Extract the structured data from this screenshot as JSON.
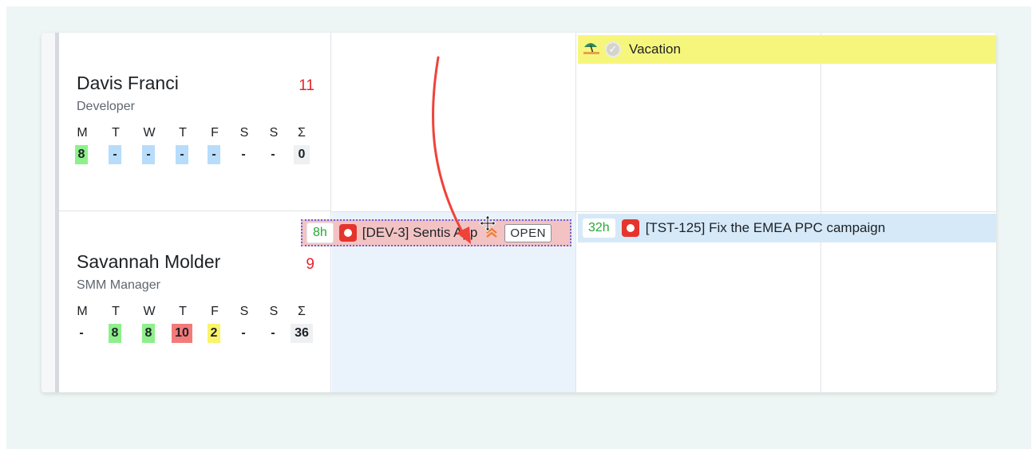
{
  "people": [
    {
      "name": "Davis Franci",
      "role": "Developer",
      "count": "11",
      "day_headers": [
        "M",
        "T",
        "W",
        "T",
        "F",
        "S",
        "S",
        "Σ"
      ],
      "day_values": [
        "8",
        "-",
        "-",
        "-",
        "-",
        "-",
        "-",
        "0"
      ]
    },
    {
      "name": "Savannah Molder",
      "role": "SMM Manager",
      "count": "9",
      "day_headers": [
        "M",
        "T",
        "W",
        "T",
        "F",
        "S",
        "S",
        "Σ"
      ],
      "day_values": [
        "-",
        "8",
        "8",
        "10",
        "2",
        "-",
        "-",
        "36"
      ]
    }
  ],
  "vacation": {
    "icon": "beach-umbrella-icon",
    "status_icon": "check-circle-icon",
    "label": "Vacation"
  },
  "tasks": {
    "campaign": {
      "hours": "32h",
      "icon": "stop-record-icon",
      "title": "[TST-125] Fix the EMEA PPC campaign"
    },
    "dragged": {
      "hours": "8h",
      "icon": "stop-record-icon",
      "title": "[DEV-3] Sentis App",
      "priority_icon": "double-chevron-up-icon",
      "status": "OPEN"
    }
  },
  "colors": {
    "overload": "#e5242b",
    "vacation_bg": "#f7f67c",
    "task_bg": "#d6e9f8",
    "dragged_bg": "#f3c3c3",
    "hours_text": "#27a836",
    "annotation_arrow": "#f0423a"
  }
}
